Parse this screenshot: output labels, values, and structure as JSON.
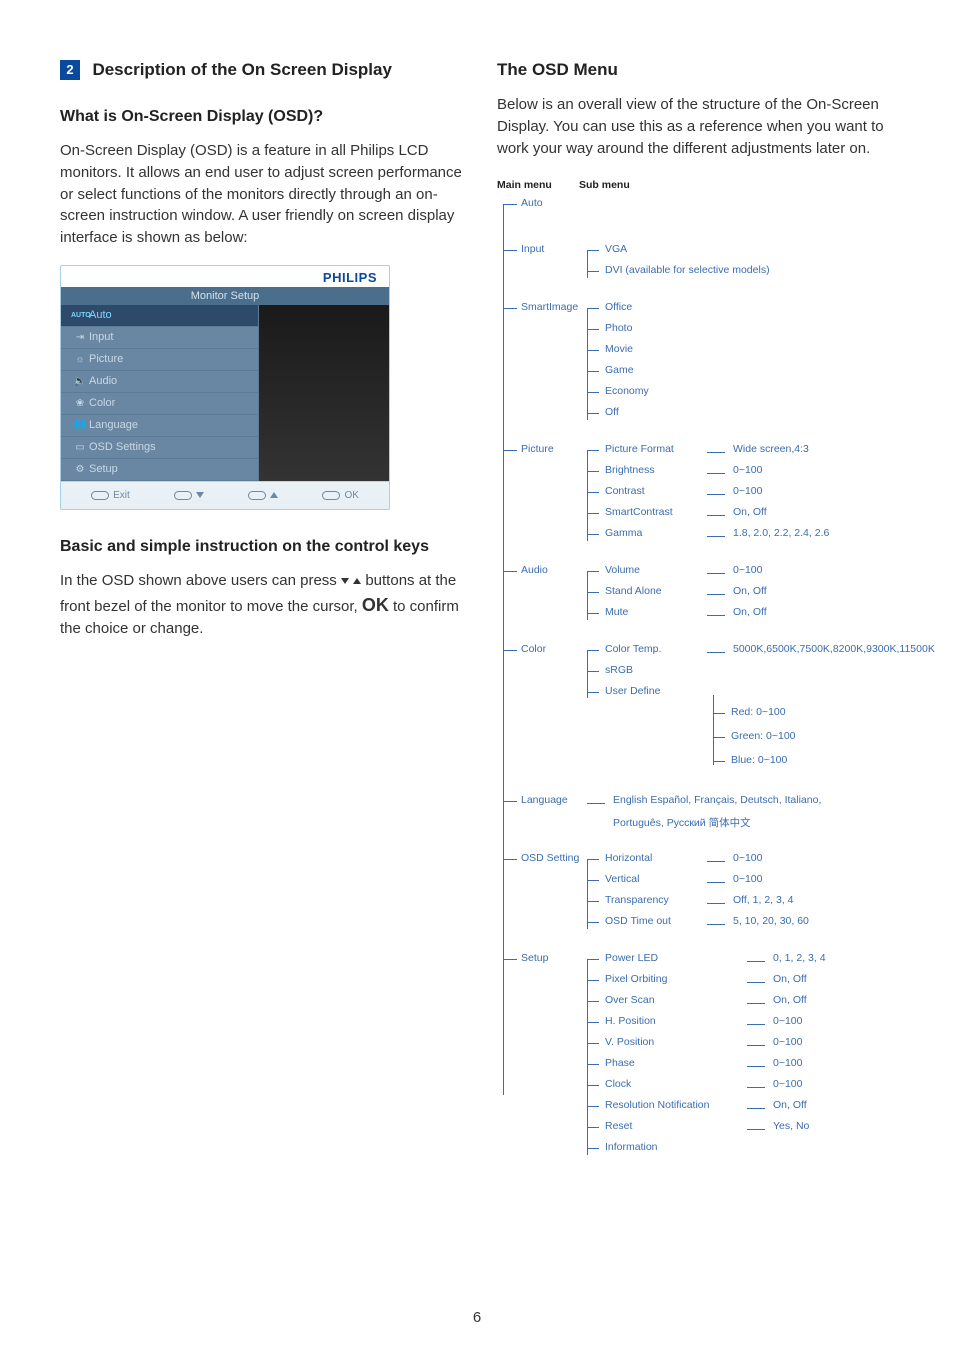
{
  "page_number": "6",
  "left": {
    "section_number": "2",
    "section_title": "Description of the On Screen Display",
    "h_what": "What is On-Screen Display (OSD)?",
    "p_what": "On-Screen Display (OSD) is a feature in all Philips LCD monitors. It allows an end user to adjust screen performance or select functions of the monitors directly through an on-screen instruction window. A user friendly on screen display interface is shown as below:",
    "osd": {
      "brand": "PHILIPS",
      "title": "Monitor Setup",
      "items": [
        {
          "icon": "AUTO",
          "label": "Auto"
        },
        {
          "icon": "⇥",
          "label": "Input"
        },
        {
          "icon": "☼",
          "label": "Picture"
        },
        {
          "icon": "🔈",
          "label": "Audio"
        },
        {
          "icon": "❀",
          "label": "Color"
        },
        {
          "icon": "🌐",
          "label": "Language"
        },
        {
          "icon": "▭",
          "label": "OSD Settings"
        },
        {
          "icon": "⚙",
          "label": "Setup"
        }
      ],
      "footer": {
        "exit": "Exit",
        "ok": "OK"
      }
    },
    "h_basic": "Basic and simple instruction on the control keys",
    "p_basic_1": "In the OSD shown above users can press ",
    "p_basic_2": " buttons at the front bezel of the monitor to move the cursor, ",
    "p_basic_ok": "OK",
    "p_basic_3": " to confirm the choice or change."
  },
  "right": {
    "h_menu": "The OSD Menu",
    "p_menu": "Below is an overall view of the structure of the On-Screen Display. You can use this as a reference when you want to work your way around the different adjustments later on.",
    "headers": {
      "main": "Main menu",
      "sub": "Sub menu"
    },
    "tree": {
      "auto": {
        "label": "Auto"
      },
      "input": {
        "label": "Input",
        "subs": [
          {
            "label": "VGA"
          },
          {
            "label": "DVI (available for selective models)"
          }
        ]
      },
      "smartimage": {
        "label": "SmartImage",
        "subs": [
          {
            "label": "Office"
          },
          {
            "label": "Photo"
          },
          {
            "label": "Movie"
          },
          {
            "label": "Game"
          },
          {
            "label": "Economy"
          },
          {
            "label": "Off"
          }
        ]
      },
      "picture": {
        "label": "Picture",
        "subs": [
          {
            "label": "Picture Format",
            "opt": "Wide screen,4:3"
          },
          {
            "label": "Brightness",
            "opt": "0~100"
          },
          {
            "label": "Contrast",
            "opt": "0~100"
          },
          {
            "label": "SmartContrast",
            "opt": "On, Off"
          },
          {
            "label": "Gamma",
            "opt": "1.8, 2.0, 2.2, 2.4, 2.6"
          }
        ]
      },
      "audio": {
        "label": "Audio",
        "subs": [
          {
            "label": "Volume",
            "opt": "0~100"
          },
          {
            "label": "Stand Alone",
            "opt": "On, Off"
          },
          {
            "label": "Mute",
            "opt": "On, Off"
          }
        ]
      },
      "color": {
        "label": "Color",
        "subs": [
          {
            "label": "Color Temp.",
            "opt": "5000K,6500K,7500K,8200K,9300K,11500K"
          },
          {
            "label": "sRGB"
          },
          {
            "label": "User Define",
            "ud": [
              {
                "label": "Red: 0~100"
              },
              {
                "label": "Green: 0~100"
              },
              {
                "label": "Blue: 0~100"
              }
            ]
          }
        ]
      },
      "language": {
        "label": "Language",
        "opt1": "English   Español, Français, Deutsch, Italiano,",
        "opt2": "Português, Русский  简体中文"
      },
      "osdsetting": {
        "label": "OSD Setting",
        "subs": [
          {
            "label": "Horizontal",
            "opt": "0~100"
          },
          {
            "label": "Vertical",
            "opt": "0~100"
          },
          {
            "label": "Transparency",
            "opt": "Off, 1, 2, 3, 4"
          },
          {
            "label": "OSD Time out",
            "opt": "5, 10, 20, 30, 60"
          }
        ]
      },
      "setup": {
        "label": "Setup",
        "subs": [
          {
            "label": "Power LED",
            "opt": "0, 1, 2, 3, 4"
          },
          {
            "label": "Pixel Orbiting",
            "opt": "On, Off"
          },
          {
            "label": "Over Scan",
            "opt": "On, Off"
          },
          {
            "label": "H. Position",
            "opt": "0~100"
          },
          {
            "label": "V. Position",
            "opt": "0~100"
          },
          {
            "label": "Phase",
            "opt": "0~100"
          },
          {
            "label": "Clock",
            "opt": "0~100"
          },
          {
            "label": "Resolution Notification",
            "opt": "On, Off"
          },
          {
            "label": "Reset",
            "opt": "Yes, No"
          },
          {
            "label": "Information"
          }
        ]
      }
    }
  }
}
